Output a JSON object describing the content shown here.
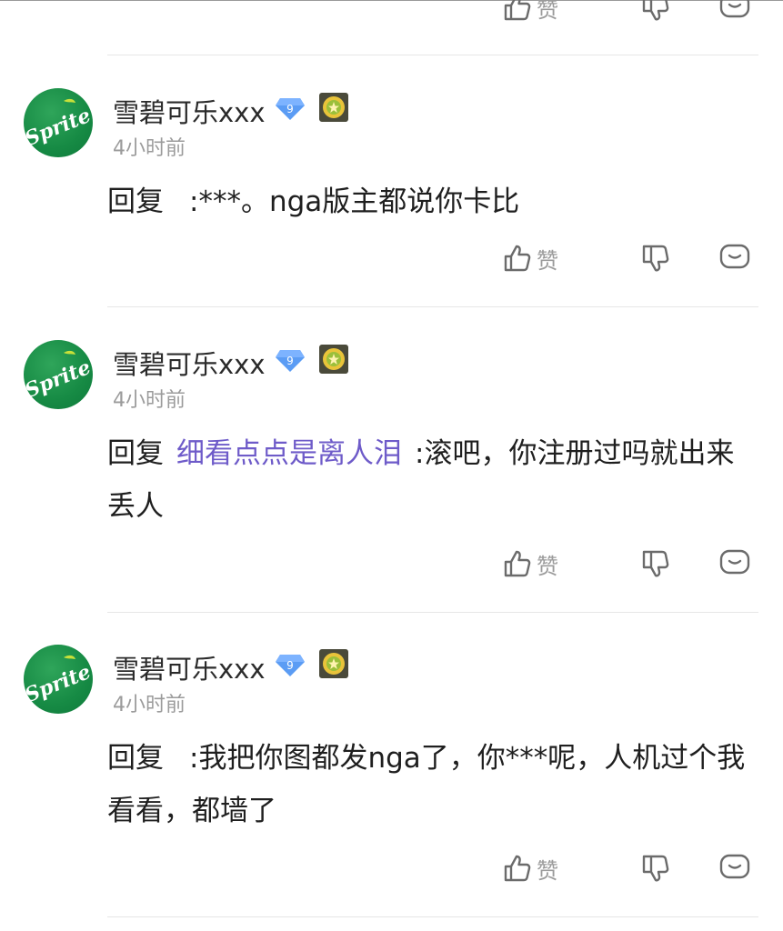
{
  "like_label": "赞",
  "colors": {
    "mention": "#6e5bc9",
    "avatar_green": "#168a44",
    "meta_gray": "#9b9b9b"
  },
  "comments": [
    {
      "username": "雪碧可乐xxx",
      "level": "9",
      "time": "4小时前",
      "avatar_text": "Sprite",
      "prefix": "回复",
      "mention": "",
      "text": ":***。nga版主都说你卡比"
    },
    {
      "username": "雪碧可乐xxx",
      "level": "9",
      "time": "4小时前",
      "avatar_text": "Sprite",
      "prefix": "回复",
      "mention": "细看点点是离人泪",
      "text": ":滚吧，你注册过吗就出来丢人"
    },
    {
      "username": "雪碧可乐xxx",
      "level": "9",
      "time": "4小时前",
      "avatar_text": "Sprite",
      "prefix": "回复",
      "mention": "",
      "text": ":我把你图都发nga了，你***呢，人机过个我看看，都墙了"
    }
  ]
}
